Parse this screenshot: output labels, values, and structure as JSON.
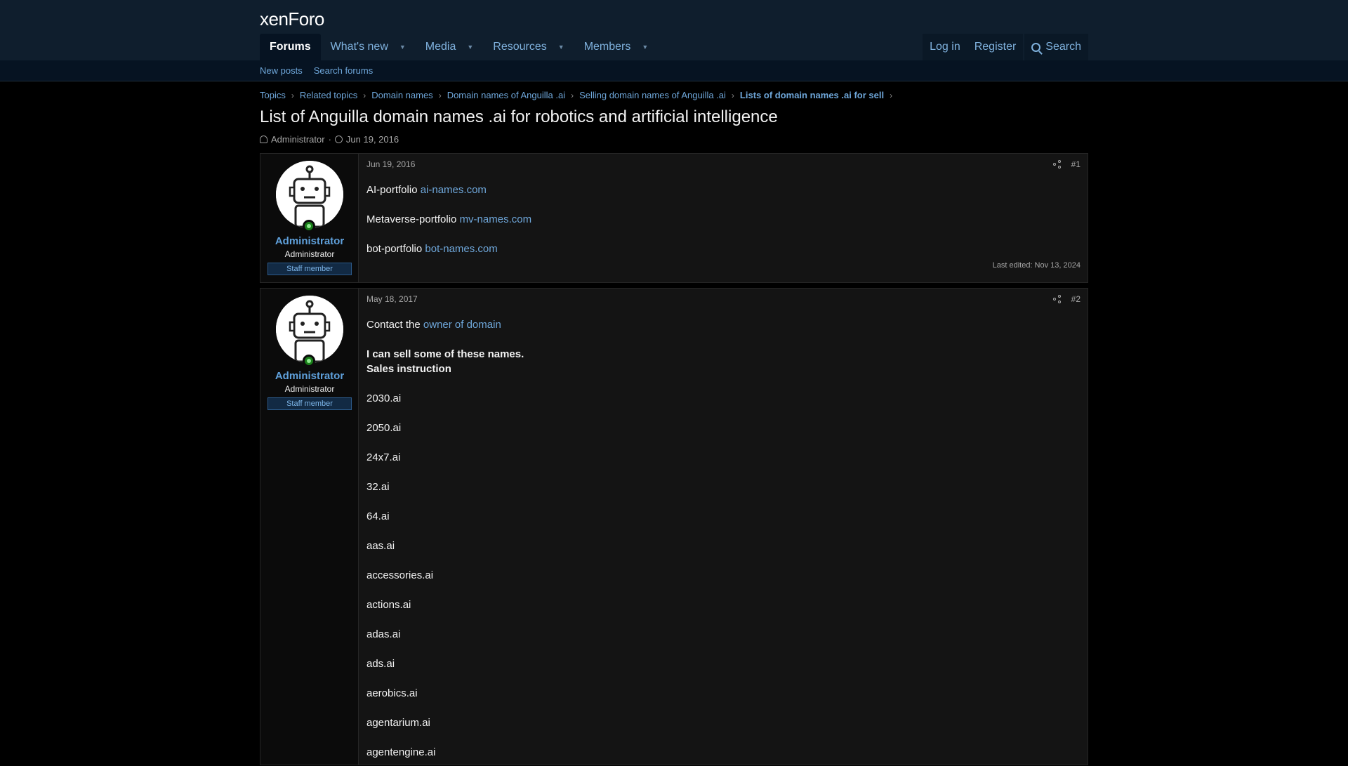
{
  "header": {
    "logo": "xenForo",
    "nav": [
      {
        "label": "Forums",
        "caret": false
      },
      {
        "label": "What's new",
        "caret": true
      },
      {
        "label": "Media",
        "caret": true
      },
      {
        "label": "Resources",
        "caret": true
      },
      {
        "label": "Members",
        "caret": true
      }
    ],
    "login": "Log in",
    "register": "Register",
    "search": "Search"
  },
  "subnav": {
    "new_posts": "New posts",
    "search_forums": "Search forums"
  },
  "breadcrumb": [
    "Topics",
    "Related topics",
    "Domain names",
    "Domain names of Anguilla .ai",
    "Selling domain names of Anguilla .ai",
    "Lists of domain names .ai for sell"
  ],
  "thread": {
    "title": "List of Anguilla domain names .ai for robotics and artificial intelligence",
    "author": "Administrator",
    "date": "Jun 19, 2016"
  },
  "posts": [
    {
      "date": "Jun 19, 2016",
      "number": "#1",
      "user": {
        "name": "Administrator",
        "title": "Administrator",
        "badge": "Staff member"
      },
      "lines": [
        {
          "text": "AI-portfolio ",
          "link": "ai-names.com"
        },
        {
          "text": "Metaverse-portfolio ",
          "link": "mv-names.com"
        },
        {
          "text": "bot-portfolio ",
          "link": "bot-names.com"
        }
      ],
      "edited": "Last edited: Nov 13, 2024"
    },
    {
      "date": "May 18, 2017",
      "number": "#2",
      "user": {
        "name": "Administrator",
        "title": "Administrator",
        "badge": "Staff member"
      },
      "contact": {
        "text": "Contact the ",
        "link": "owner of domain"
      },
      "bold_line": "I can sell some of these names.",
      "sales_link": "Sales instruction",
      "domains": [
        "2030.ai",
        "2050.ai",
        "24x7.ai",
        "32.ai",
        "64.ai",
        "aas.ai",
        "accessories.ai",
        "actions.ai",
        "adas.ai",
        "ads.ai",
        "aerobics.ai",
        "agentarium.ai",
        "agentengine.ai"
      ]
    }
  ]
}
